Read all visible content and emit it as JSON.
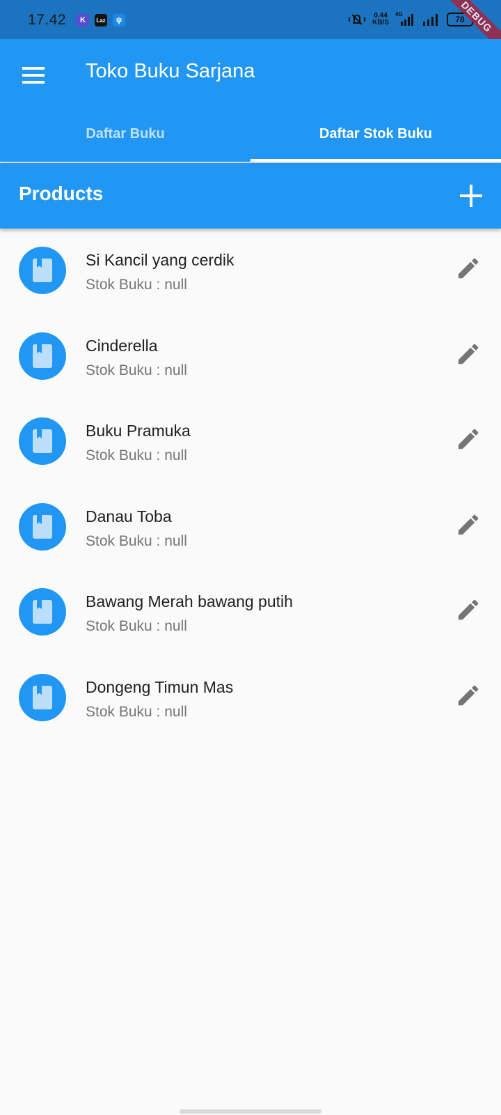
{
  "status_bar": {
    "time": "17.42",
    "app_icons": [
      {
        "name": "kuaishou-app-icon",
        "glyph": "K",
        "color": "#5b4bd1"
      },
      {
        "name": "lazada-app-icon",
        "glyph": "Laz",
        "color": "#111111"
      },
      {
        "name": "usb-debug-icon",
        "glyph": "ψ",
        "color": "#1e88e5"
      }
    ],
    "net_speed_value": "0.44",
    "net_speed_unit": "KB/S",
    "network_type": "4G",
    "battery": "78",
    "debug_banner": "DEBUG"
  },
  "app_bar": {
    "title": "Toko Buku Sarjana",
    "tabs": [
      {
        "label": "Daftar Buku",
        "active": false
      },
      {
        "label": "Daftar Stok Buku",
        "active": true
      }
    ]
  },
  "products_header": {
    "title": "Products"
  },
  "books": [
    {
      "title": "Si Kancil yang cerdik",
      "stock": "Stok Buku : null"
    },
    {
      "title": "Cinderella",
      "stock": "Stok Buku : null"
    },
    {
      "title": "Buku Pramuka",
      "stock": "Stok Buku : null"
    },
    {
      "title": "Danau Toba",
      "stock": "Stok Buku : null"
    },
    {
      "title": "Bawang Merah bawang putih",
      "stock": "Stok Buku : null"
    },
    {
      "title": "Dongeng Timun Mas",
      "stock": "Stok Buku : null"
    }
  ],
  "colors": {
    "primary": "#2196f3",
    "status_bar": "#1c74c1",
    "background": "#fafafa",
    "icon_grey": "#757575"
  }
}
